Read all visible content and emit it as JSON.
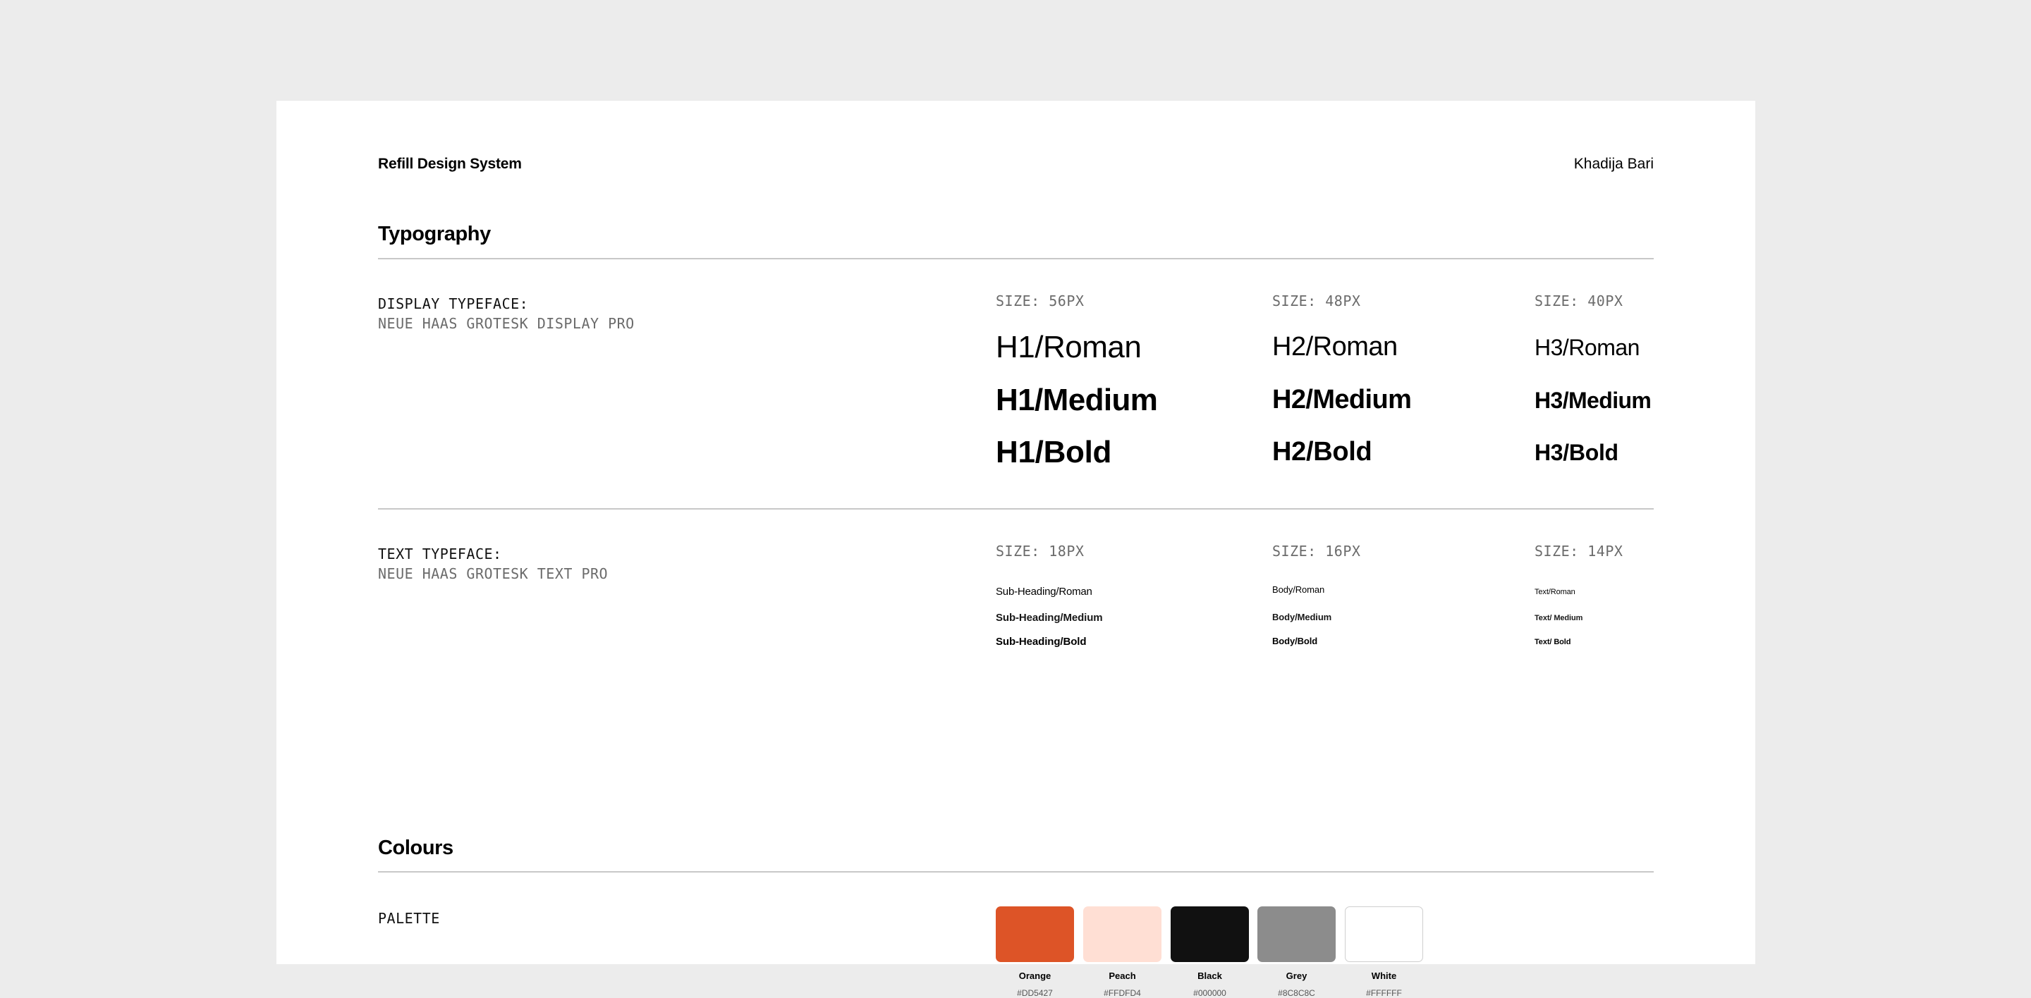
{
  "header": {
    "brand": "Refill Design System",
    "author": "Khadija Bari"
  },
  "typography": {
    "title": "Typography",
    "display": {
      "label": "DISPLAY TYPEFACE:",
      "typeface": "NEUE HAAS GROTESK DISPLAY PRO",
      "columns": [
        {
          "size_label": "SIZE: 56PX",
          "roman": "H1/Roman",
          "medium": "H1/Medium",
          "bold": "H1/Bold"
        },
        {
          "size_label": "SIZE: 48PX",
          "roman": "H2/Roman",
          "medium": "H2/Medium",
          "bold": "H2/Bold"
        },
        {
          "size_label": "SIZE: 40PX",
          "roman": "H3/Roman",
          "medium": "H3/Medium",
          "bold": "H3/Bold"
        }
      ]
    },
    "text": {
      "label": "TEXT TYPEFACE:",
      "typeface": "NEUE HAAS GROTESK TEXT PRO",
      "columns": [
        {
          "size_label": "SIZE: 18PX",
          "roman": "Sub-Heading/Roman",
          "medium": "Sub-Heading/Medium",
          "bold": "Sub-Heading/Bold"
        },
        {
          "size_label": "SIZE: 16PX",
          "roman": "Body/Roman",
          "medium": "Body/Medium",
          "bold": "Body/Bold"
        },
        {
          "size_label": "SIZE: 14PX",
          "roman": "Text/Roman",
          "medium": "Text/ Medium",
          "bold": "Text/ Bold"
        }
      ]
    }
  },
  "colours": {
    "title": "Colours",
    "palette_label": "PALETTE",
    "swatches": [
      {
        "name": "Orange",
        "hex": "#DD5427",
        "color": "#DD5427"
      },
      {
        "name": "Peach",
        "hex": "#FFDFD4",
        "color": "#FFDFD4"
      },
      {
        "name": "Black",
        "hex": "#000000",
        "color": "#111111"
      },
      {
        "name": "Grey",
        "hex": "#8C8C8C",
        "color": "#8C8C8C"
      },
      {
        "name": "White",
        "hex": "#FFFFFF",
        "color": "#FFFFFF"
      }
    ]
  }
}
